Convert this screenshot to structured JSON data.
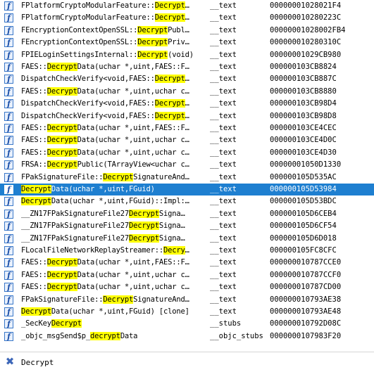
{
  "rows": [
    {
      "pre": "FPlatformCryptoModularFeature::",
      "hl": "Decrypt",
      "post": "…",
      "segment": "__text",
      "address": "00000001028021F4"
    },
    {
      "pre": "FPlatformCryptoModularFeature::",
      "hl": "Decrypt",
      "post": "…",
      "segment": "__text",
      "address": "000000010280223C"
    },
    {
      "pre": "FEncryptionContextOpenSSL::",
      "hl": "Decrypt",
      "post": "Publ…",
      "segment": "__text",
      "address": "00000001028002FB4"
    },
    {
      "pre": "FEncryptionContextOpenSSL::",
      "hl": "Decrypt",
      "post": "Priv…",
      "segment": "__text",
      "address": "000000010280310C"
    },
    {
      "pre": "FPIELoginSettingsInternal::",
      "hl": "Decrypt",
      "post": "(void)",
      "segment": "__text",
      "address": "00000001029CB980"
    },
    {
      "pre": "FAES::",
      "hl": "Decrypt",
      "post": "Data(uchar *,uint,FAES::F…",
      "segment": "__text",
      "address": "000000103CB8824"
    },
    {
      "pre": "DispatchCheckVerify<void,FAES::",
      "hl": "Decrypt",
      "post": "…",
      "segment": "__text",
      "address": "000000103CB887C"
    },
    {
      "pre": "FAES::",
      "hl": "Decrypt",
      "post": "Data(uchar *,uint,uchar c…",
      "segment": "__text",
      "address": "000000103CB8880"
    },
    {
      "pre": "DispatchCheckVerify<void,FAES::",
      "hl": "Decrypt",
      "post": "…",
      "segment": "__text",
      "address": "000000103CB98D4"
    },
    {
      "pre": "DispatchCheckVerify<void,FAES::",
      "hl": "Decrypt",
      "post": "…",
      "segment": "__text",
      "address": "000000103CB98D8"
    },
    {
      "pre": "FAES::",
      "hl": "Decrypt",
      "post": "Data(uchar *,uint,FAES::F…",
      "segment": "__text",
      "address": "000000103CE4CEC"
    },
    {
      "pre": "FAES::",
      "hl": "Decrypt",
      "post": "Data(uchar *,uint,uchar c…",
      "segment": "__text",
      "address": "000000103CE4D0C"
    },
    {
      "pre": "FAES::",
      "hl": "Decrypt",
      "post": "Data(uchar *,uint,uchar c…",
      "segment": "__text",
      "address": "000000103CE4D30"
    },
    {
      "pre": "FRSA::",
      "hl": "Decrypt",
      "post": "Public(TArrayView<uchar c…",
      "segment": "__text",
      "address": "00000001050D1330"
    },
    {
      "pre": "FPakSignatureFile::",
      "hl": "Decrypt",
      "post": "SignatureAnd…",
      "segment": "__text",
      "address": "000000105D535AC"
    },
    {
      "pre": "",
      "hl": "Decrypt",
      "post": "Data(uchar *,uint,FGuid)",
      "segment": "__text",
      "address": "000000105D53984",
      "selected": true
    },
    {
      "pre": "",
      "hl": "Decrypt",
      "post": "Data(uchar *,uint,FGuid)::Impl:…",
      "segment": "__text",
      "address": "000000105D53BDC"
    },
    {
      "pre": "__ZN17FPakSignatureFile27",
      "hl": "Decrypt",
      "post": "Signa…",
      "segment": "__text",
      "address": "000000105D6CEB4"
    },
    {
      "pre": "__ZN17FPakSignatureFile27",
      "hl": "Decrypt",
      "post": "Signa…",
      "segment": "__text",
      "address": "000000105D6CF54"
    },
    {
      "pre": "__ZN17FPakSignatureFile27",
      "hl": "Decrypt",
      "post": "Signa…",
      "segment": "__text",
      "address": "000000105D6D018"
    },
    {
      "pre": "FLocalFileNetworkReplayStreamer::",
      "hl": "Decry",
      "post": "…",
      "segment": "__text",
      "address": "000000105FC8CFC"
    },
    {
      "pre": "FAES::",
      "hl": "Decrypt",
      "post": "Data(uchar *,uint,FAES::F…",
      "segment": "__text",
      "address": "000000010787CCE0"
    },
    {
      "pre": "FAES::",
      "hl": "Decrypt",
      "post": "Data(uchar *,uint,uchar c…",
      "segment": "__text",
      "address": "000000010787CCF0"
    },
    {
      "pre": "FAES::",
      "hl": "Decrypt",
      "post": "Data(uchar *,uint,uchar c…",
      "segment": "__text",
      "address": "000000010787CD00"
    },
    {
      "pre": "FPakSignatureFile::",
      "hl": "Decrypt",
      "post": "SignatureAnd…",
      "segment": "__text",
      "address": "000000010793AE38"
    },
    {
      "pre": "",
      "hl": "Decrypt",
      "post": "Data(uchar *,uint,FGuid) [clone]",
      "segment": "__text",
      "address": "000000010793AE48"
    },
    {
      "pre": "_SecKey",
      "hl": "Decrypt",
      "post": "",
      "segment": "__stubs",
      "address": "000000010792D08C"
    },
    {
      "pre": "_objc_msgSend$p_",
      "hl": "decrypt",
      "post": "Data",
      "segment": "__objc_stubs",
      "address": "0000000107983F20"
    }
  ],
  "icon_glyph": "f",
  "filter": {
    "value": "Decrypt",
    "clear_icon": "clear-filter-icon"
  },
  "colors": {
    "highlight": "#ffff00",
    "selection": "#1e7fd0"
  }
}
